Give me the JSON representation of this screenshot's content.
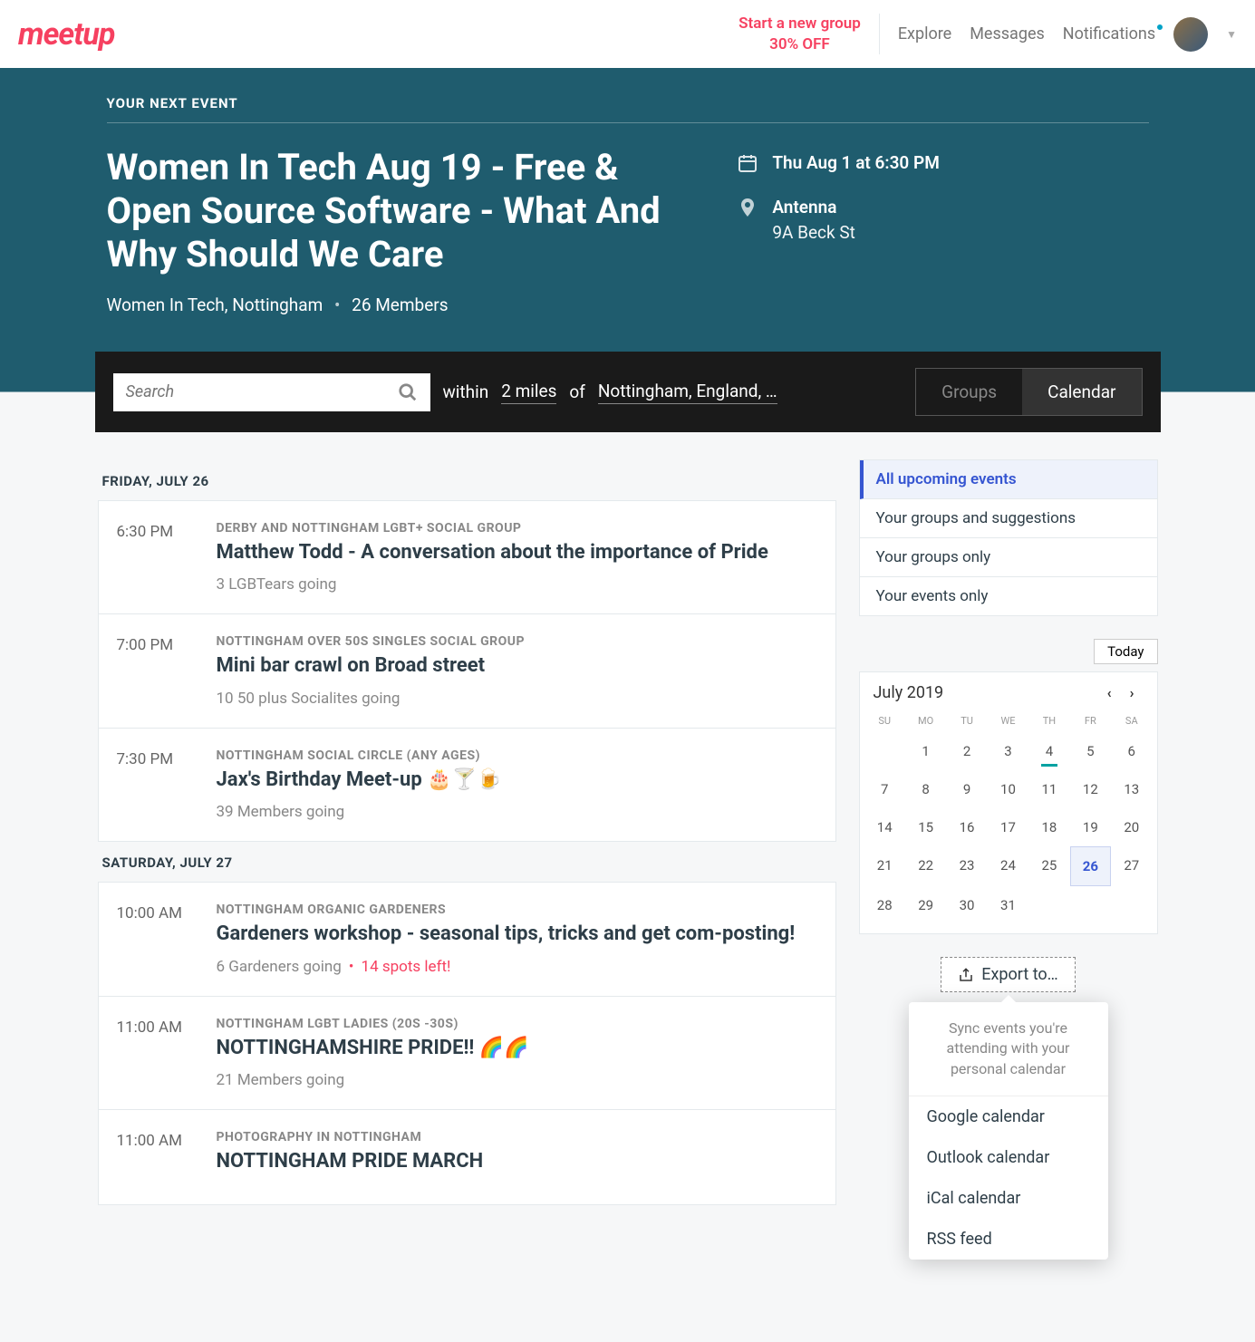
{
  "topbar": {
    "logo": "meetup",
    "promo_line1": "Start a new group",
    "promo_line2": "30% OFF",
    "nav": {
      "explore": "Explore",
      "messages": "Messages",
      "notifications": "Notifications"
    }
  },
  "hero": {
    "label": "YOUR NEXT EVENT",
    "title": "Women In Tech Aug 19 - Free & Open Source Software - What And Why Should We Care",
    "group": "Women In Tech, Nottingham",
    "members": "26 Members",
    "datetime": "Thu Aug 1 at 6:30 PM",
    "venue": "Antenna",
    "address": "9A Beck St"
  },
  "search": {
    "placeholder": "Search",
    "within": "within",
    "distance": "2 miles",
    "of": "of",
    "location": "Nottingham, England, …",
    "toggle_groups": "Groups",
    "toggle_calendar": "Calendar"
  },
  "days": [
    {
      "header": "FRIDAY, JULY 26",
      "events": [
        {
          "time": "6:30 PM",
          "group": "DERBY AND NOTTINGHAM LGBT+ SOCIAL GROUP",
          "title": "Matthew Todd - A conversation about the importance of Pride",
          "going": "3 LGBTears going",
          "spots": ""
        },
        {
          "time": "7:00 PM",
          "group": "NOTTINGHAM OVER 50S SINGLES SOCIAL GROUP",
          "title": "Mini bar crawl on Broad street",
          "going": "10 50 plus Socialites going",
          "spots": ""
        },
        {
          "time": "7:30 PM",
          "group": "NOTTINGHAM SOCIAL CIRCLE (ANY AGES)",
          "title": "Jax's Birthday Meet-up 🎂🍸🍺",
          "going": "39 Members going",
          "spots": ""
        }
      ]
    },
    {
      "header": "SATURDAY, JULY 27",
      "events": [
        {
          "time": "10:00 AM",
          "group": "NOTTINGHAM ORGANIC GARDENERS",
          "title": "Gardeners workshop - seasonal tips, tricks and get com-posting!",
          "going": "6 Gardeners going",
          "spots": "14 spots left!"
        },
        {
          "time": "11:00 AM",
          "group": "NOTTINGHAM LGBT LADIES (20S -30S)",
          "title": "NOTTINGHAMSHIRE PRIDE!! 🌈🌈",
          "going": "21 Members going",
          "spots": ""
        },
        {
          "time": "11:00 AM",
          "group": "PHOTOGRAPHY IN NOTTINGHAM",
          "title": "NOTTINGHAM PRIDE MARCH",
          "going": "",
          "spots": ""
        }
      ]
    }
  ],
  "filters": {
    "all": "All upcoming events",
    "suggestions": "Your groups and suggestions",
    "groups": "Your groups only",
    "events": "Your events only"
  },
  "calendar": {
    "today_btn": "Today",
    "month": "July 2019",
    "dow": [
      "SU",
      "MO",
      "TU",
      "WE",
      "TH",
      "FR",
      "SA"
    ],
    "selected": 26,
    "marked": 4
  },
  "export": {
    "btn": "Export to…",
    "desc": "Sync events you're attending with your personal calendar",
    "options": [
      "Google calendar",
      "Outlook calendar",
      "iCal calendar",
      "RSS feed"
    ]
  }
}
